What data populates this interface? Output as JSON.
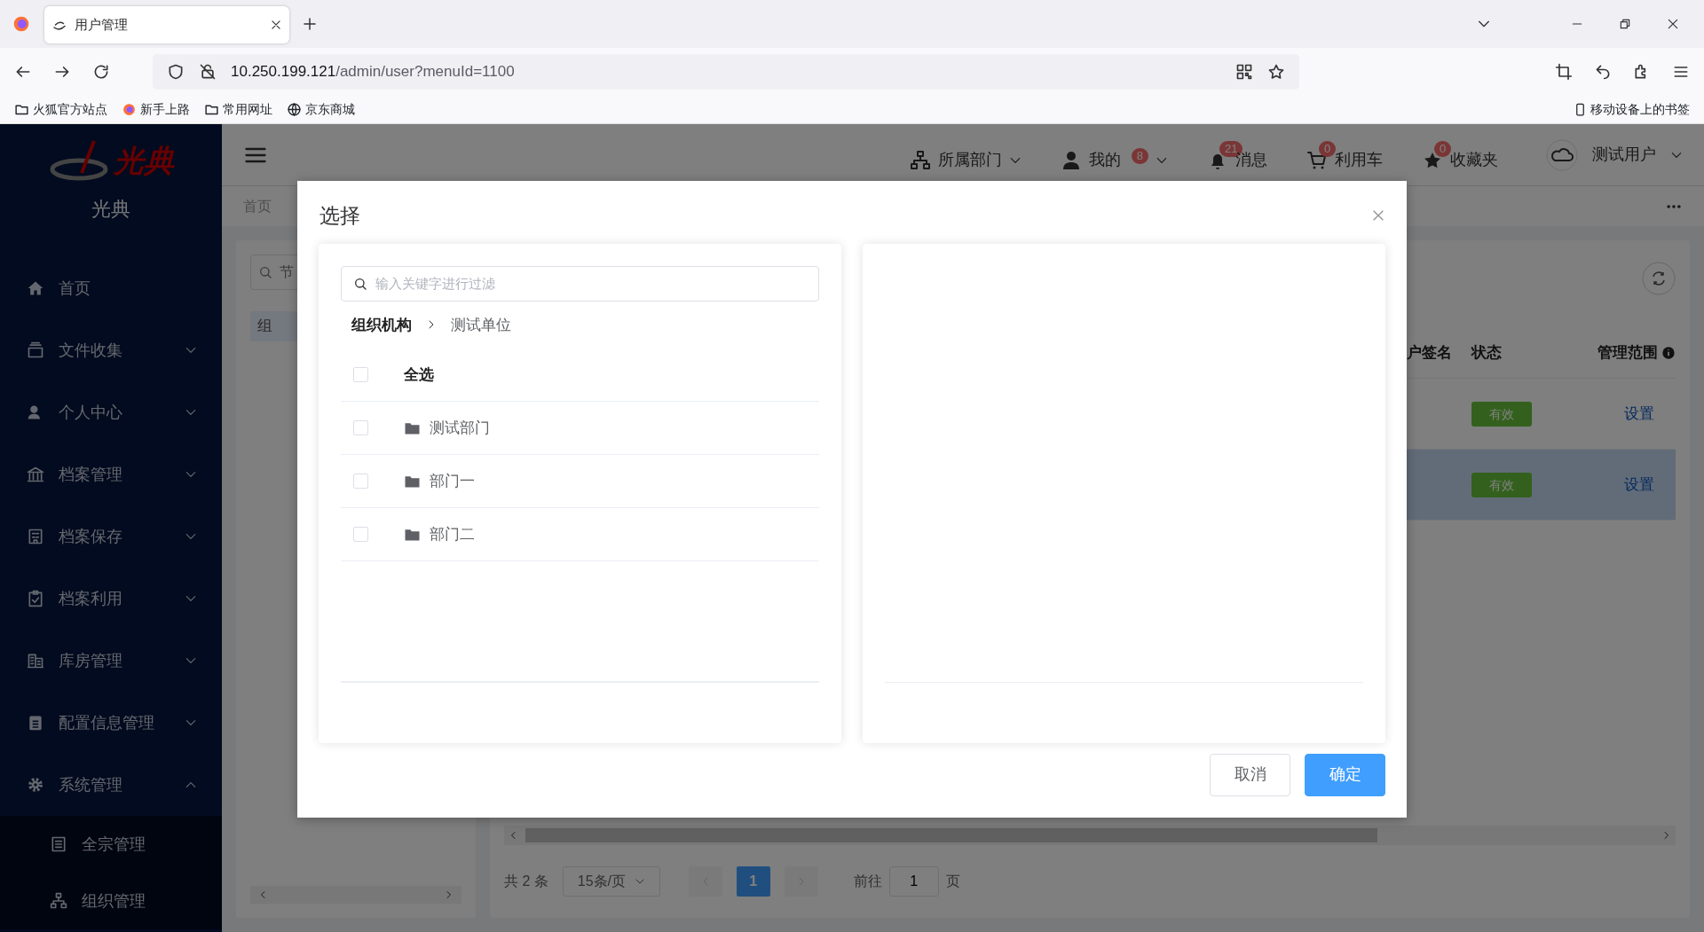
{
  "browser": {
    "tab_title": "用户管理",
    "url_host": "10.250.199.121",
    "url_path": "/admin/user?menuId=1100",
    "bookmarks": [
      "火狐官方站点",
      "新手上路",
      "常用网址",
      "京东商城"
    ],
    "mobile_bookmarks": "移动设备上的书签"
  },
  "sidebar": {
    "logo_text": "光典",
    "brand": "光典",
    "items": [
      {
        "label": "首页",
        "kind": "leaf"
      },
      {
        "label": "文件收集",
        "kind": "group",
        "expanded": false
      },
      {
        "label": "个人中心",
        "kind": "group",
        "expanded": false
      },
      {
        "label": "档案管理",
        "kind": "group",
        "expanded": false
      },
      {
        "label": "档案保存",
        "kind": "group",
        "expanded": false
      },
      {
        "label": "档案利用",
        "kind": "group",
        "expanded": false
      },
      {
        "label": "库房管理",
        "kind": "group",
        "expanded": false
      },
      {
        "label": "配置信息管理",
        "kind": "group",
        "expanded": false
      },
      {
        "label": "系统管理",
        "kind": "group",
        "expanded": true,
        "children": [
          {
            "label": "全宗管理"
          },
          {
            "label": "组织管理"
          }
        ]
      }
    ]
  },
  "header": {
    "items": [
      {
        "label": "所属部门",
        "dropdown": true
      },
      {
        "label": "我的",
        "badge": "8",
        "dropdown": true
      },
      {
        "label": "消息",
        "badge": "21",
        "dropdown": false
      },
      {
        "label": "利用车",
        "badge": "0",
        "dropdown": false
      },
      {
        "label": "收藏夹",
        "badge": "0",
        "dropdown": false
      }
    ],
    "user": "测试用户"
  },
  "breadcrumb": "首页",
  "tree_panel": {
    "search_placeholder": "节",
    "item": "组"
  },
  "table": {
    "columns": [
      "户签名",
      "状态",
      "管理范围"
    ],
    "rows": [
      {
        "status": "有效",
        "action": "设置",
        "selected": false
      },
      {
        "status": "有效",
        "action": "设置",
        "selected": true
      }
    ]
  },
  "pagination": {
    "total": "共 2 条",
    "page_size": "15条/页",
    "pages": [
      {
        "label": "1",
        "selected": true
      }
    ],
    "goto_label": "前往",
    "goto_value": "1",
    "goto_suffix": "页"
  },
  "dialog": {
    "title": "选择",
    "search_placeholder": "输入关键字进行过滤",
    "path": [
      "组织机构",
      "测试单位"
    ],
    "select_all": {
      "label": "全选",
      "checked": false
    },
    "items": [
      {
        "label": "测试部门",
        "checked": false
      },
      {
        "label": "部门一",
        "checked": false
      },
      {
        "label": "部门二",
        "checked": false
      }
    ],
    "buttons": [
      {
        "label": "取消",
        "kind": "secondary"
      },
      {
        "label": "确定",
        "kind": "primary"
      }
    ]
  }
}
